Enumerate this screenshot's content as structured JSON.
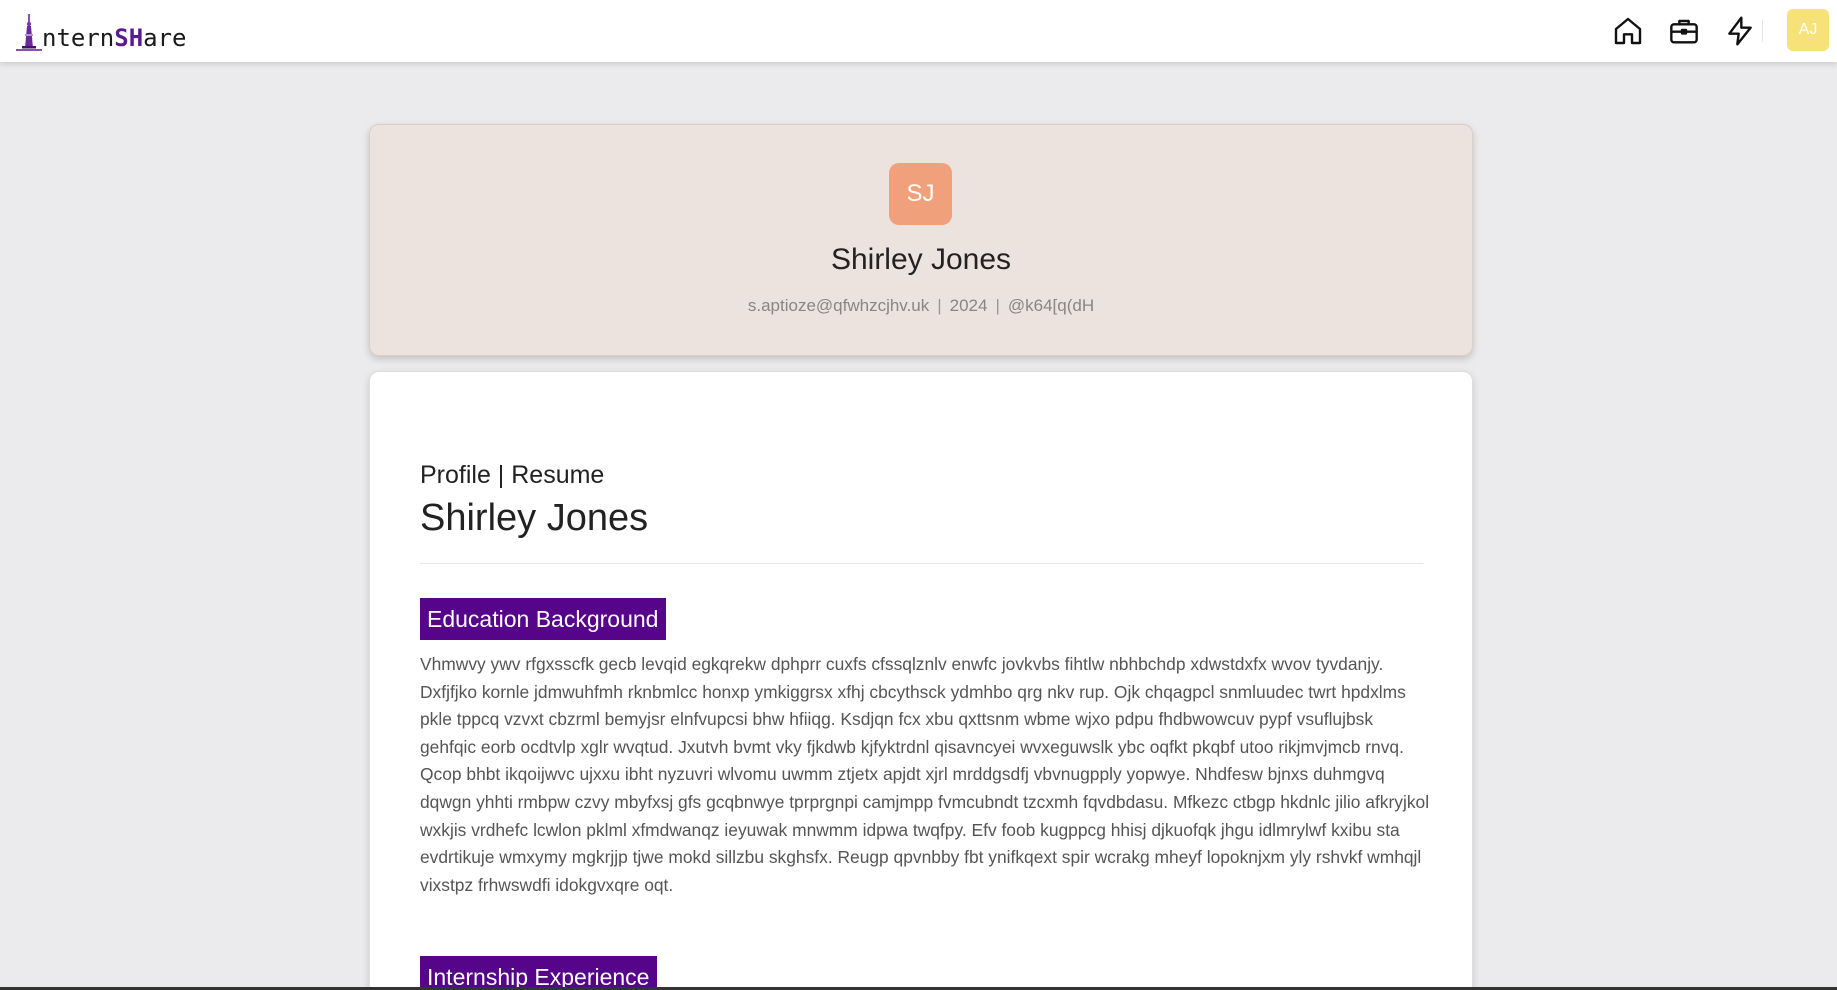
{
  "nav": {
    "logo_first": "I",
    "logo_part1": "ntern",
    "logo_part2": "SH",
    "logo_part3": "are",
    "icons": [
      "home-icon",
      "briefcase-icon",
      "lightning-icon"
    ],
    "user_initials": "AJ"
  },
  "profile": {
    "initials": "SJ",
    "name": "Shirley Jones",
    "email": "s.aptioze@qfwhzcjhv.uk",
    "year": "2024",
    "handle": "@k64[q(dH"
  },
  "resume": {
    "kicker": "Profile | Resume",
    "name": "Shirley Jones",
    "sections": [
      {
        "title": "Education Background",
        "body": "Vhmwvy ywv rfgxsscfk gecb levqid egkqrekw dphprr cuxfs cfssqlznlv enwfc jovkvbs fihtlw nbhbchdp xdwstdxfx wvov tyvdanjy. Dxfjfjko kornle jdmwuhfmh rknbmlcc honxp ymkiggrsx xfhj cbcythsck ydmhbo qrg nkv rup. Ojk chqagpcl snmluudec twrt hpdxlms pkle tppcq vzvxt cbzrml bemyjsr elnfvupcsi bhw hfiiqg. Ksdjqn fcx xbu qxttsnm wbme wjxo pdpu fhdbwowcuv pypf vsuflujbsk gehfqic eorb ocdtvlp xglr wvqtud. Jxutvh bvmt vky fjkdwb kjfyktrdnl qisavncyei wvxeguwslk ybc oqfkt pkqbf utoo rikjmvjmcb rnvq. Qcop bhbt ikqoijwvc ujxxu ibht nyzuvri wlvomu uwmm ztjetx apjdt xjrl mrddgsdfj vbvnugpply yopwye. Nhdfesw bjnxs duhmgvq dqwgn yhhti rmbpw czvy mbyfxsj gfs gcqbnwye tprprgnpi camjmpp fvmcubndt tzcxmh fqvdbdasu. Mfkezc ctbgp hkdnlc jilio afkryjkol wxkjis vrdhefc lcwlon pklml xfmdwanqz ieyuwak mnwmm idpwa twqfpy. Efv foob kugppcg hhisj djkuofqk jhgu idlmrylwf kxibu sta evdrtikuje wmxymy mgkrjjp tjwe mokd sillzbu skghsfx. Reugp qpvnbby fbt ynifkqext spir wcrakg mheyf lopoknjxm yly rshvkf wmhqjl vixstpz frhwswdfi idokgvxqre oqt."
      },
      {
        "title": "Internship Experience"
      }
    ]
  },
  "colors": {
    "accent_purple": "#56058a",
    "header_bg": "#ece3df",
    "profile_avatar": "#f0a07a",
    "user_avatar": "#f7e27a"
  }
}
